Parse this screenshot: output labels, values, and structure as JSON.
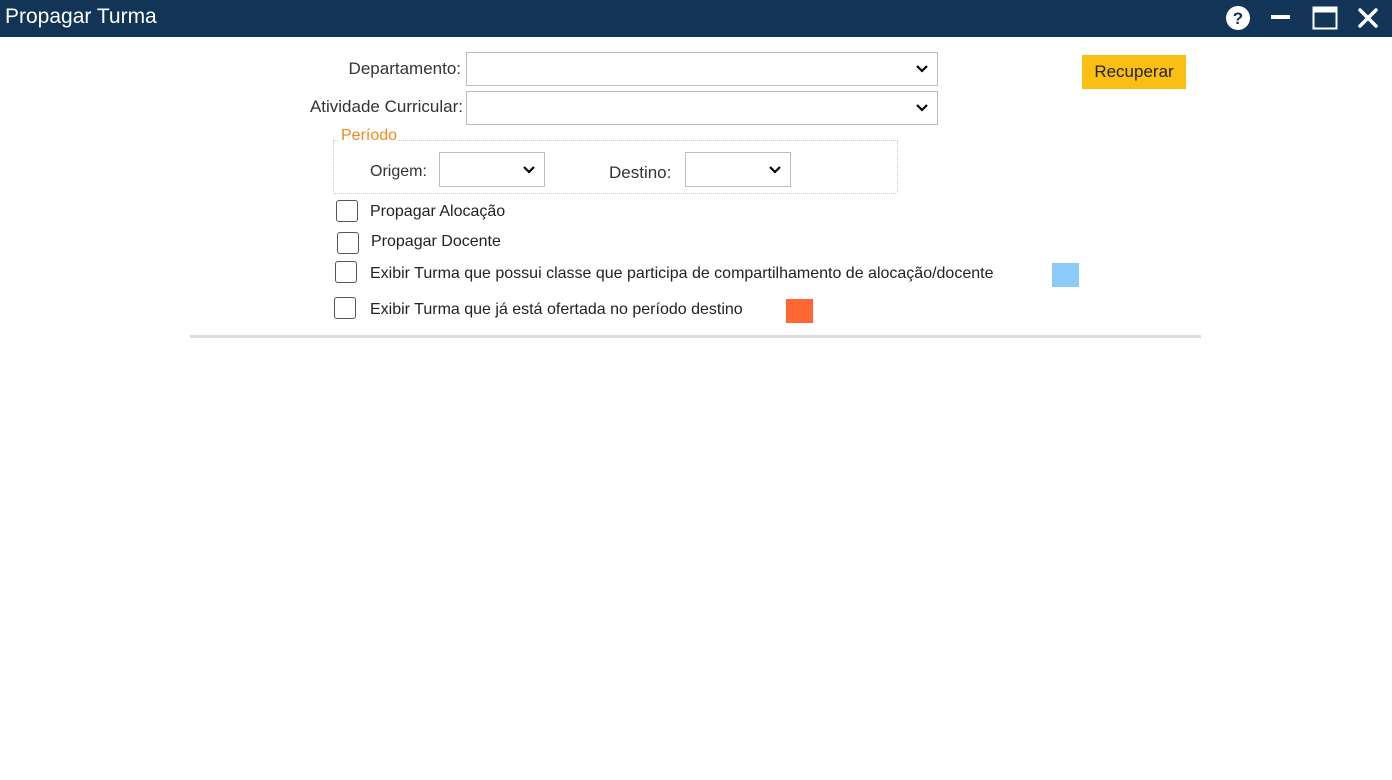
{
  "window": {
    "title": "Propagar Turma",
    "controls": [
      "help-icon",
      "minimize-icon",
      "maximize-icon",
      "close-icon"
    ]
  },
  "form": {
    "departamento": {
      "label": "Departamento:",
      "value": ""
    },
    "atividade": {
      "label": "Atividade Curricular:",
      "value": ""
    },
    "recuperar_label": "Recuperar",
    "periodo": {
      "legend": "Período",
      "origem": {
        "label": "Origem:",
        "value": ""
      },
      "destino": {
        "label": "Destino:",
        "value": ""
      }
    },
    "checkboxes": [
      {
        "label": "Propagar Alocação",
        "checked": false
      },
      {
        "label": "Propagar Docente",
        "checked": false
      },
      {
        "label": "Exibir Turma que possui classe que participa de compartilhamento de alocação/docente",
        "checked": false,
        "swatch": "#8ccbf7"
      },
      {
        "label": "Exibir Turma que já está ofertada no período destino",
        "checked": false,
        "swatch": "#fe6633"
      }
    ]
  },
  "colors": {
    "titlebar": "#123456",
    "accent_button": "#f9bf13",
    "legend": "#f08a1c"
  }
}
